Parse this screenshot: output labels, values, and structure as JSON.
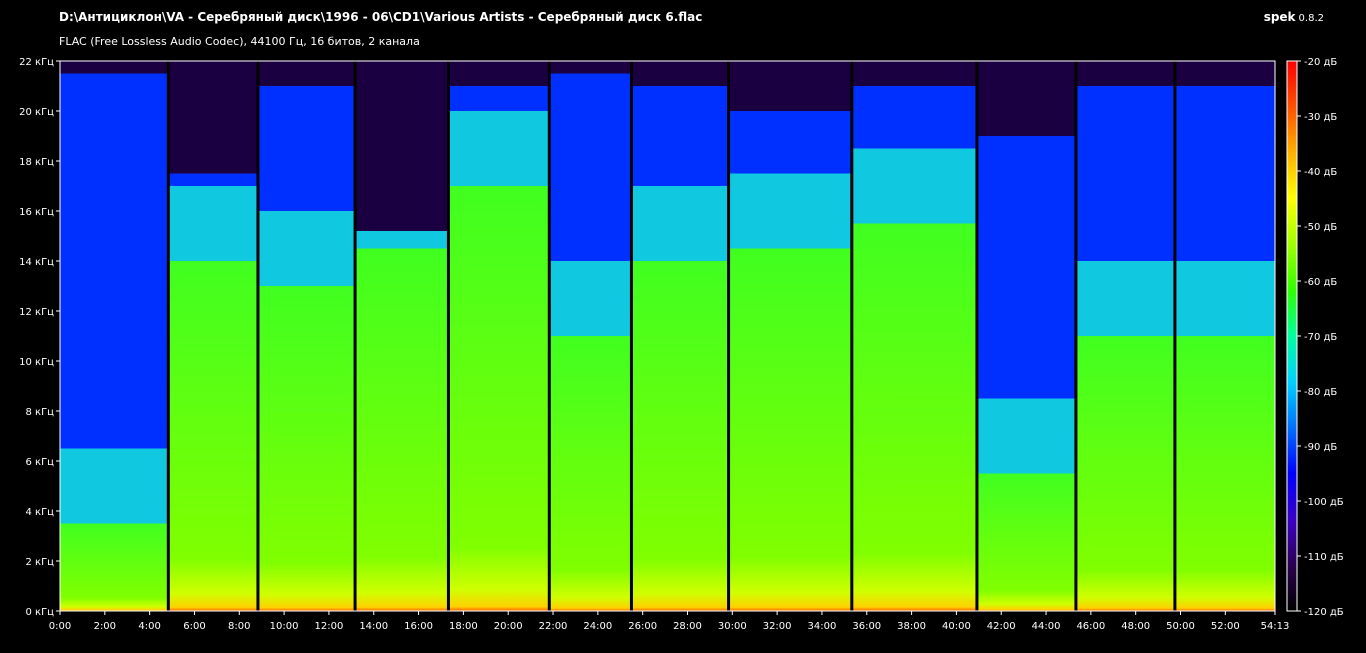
{
  "header": {
    "file_path": "D:\\Антициклон\\VA - Серебряный диск\\1996 - 06\\CD1\\Various Artists - Серебряный диск 6.flac",
    "app_name": "spek",
    "app_version": "0.8.2",
    "file_info": "FLAC (Free Lossless Audio Codec), 44100 Гц, 16 битов, 2 канала"
  },
  "chart_data": {
    "type": "heatmap",
    "title": "",
    "x_axis": {
      "unit": "time",
      "range": [
        "0:00",
        "54:13"
      ],
      "range_seconds": [
        0,
        3253
      ],
      "tick_labels": [
        "0:00",
        "2:00",
        "4:00",
        "6:00",
        "8:00",
        "10:00",
        "12:00",
        "14:00",
        "16:00",
        "18:00",
        "20:00",
        "22:00",
        "24:00",
        "26:00",
        "28:00",
        "30:00",
        "32:00",
        "34:00",
        "36:00",
        "38:00",
        "40:00",
        "42:00",
        "44:00",
        "46:00",
        "48:00",
        "50:00",
        "52:00",
        "54:13"
      ],
      "tick_seconds": [
        0,
        120,
        240,
        360,
        480,
        600,
        720,
        840,
        960,
        1080,
        1200,
        1320,
        1440,
        1560,
        1680,
        1800,
        1920,
        2040,
        2160,
        2280,
        2400,
        2520,
        2640,
        2760,
        2880,
        3000,
        3120,
        3253
      ]
    },
    "y_axis": {
      "unit": "кГц",
      "range": [
        0,
        22
      ],
      "tick_labels": [
        "0 кГц",
        "2 кГц",
        "4 кГц",
        "6 кГц",
        "8 кГц",
        "10 кГц",
        "12 кГц",
        "14 кГц",
        "16 кГц",
        "18 кГц",
        "20 кГц",
        "22 кГц"
      ],
      "tick_values": [
        0,
        2,
        4,
        6,
        8,
        10,
        12,
        14,
        16,
        18,
        20,
        22
      ]
    },
    "color_scale": {
      "unit": "дБ",
      "range": [
        -120,
        -20
      ],
      "tick_labels": [
        "-20 дБ",
        "-30 дБ",
        "-40 дБ",
        "-50 дБ",
        "-60 дБ",
        "-70 дБ",
        "-80 дБ",
        "-90 дБ",
        "-100 дБ",
        "-110 дБ",
        "-120 дБ"
      ],
      "tick_values": [
        -20,
        -30,
        -40,
        -50,
        -60,
        -70,
        -80,
        -90,
        -100,
        -110,
        -120
      ],
      "gradient": [
        "#000000",
        "#2a0050",
        "#3a00c8",
        "#0000ff",
        "#0070ff",
        "#00d0ff",
        "#00ffa0",
        "#30ff00",
        "#a0ff00",
        "#ffff00",
        "#ffb000",
        "#ff5000",
        "#ff0000"
      ]
    },
    "track_boundaries_seconds": [
      290,
      530,
      790,
      1040,
      1310,
      1530,
      1790,
      2120,
      2455,
      2720,
      2985
    ],
    "tracks": [
      {
        "start": 0,
        "end": 290,
        "cutoff_khz": 21.5,
        "green_top_khz": 3.5
      },
      {
        "start": 290,
        "end": 530,
        "cutoff_khz": 17.5,
        "green_top_khz": 14.0
      },
      {
        "start": 530,
        "end": 790,
        "cutoff_khz": 21.0,
        "green_top_khz": 13.0
      },
      {
        "start": 790,
        "end": 1040,
        "cutoff_khz": 15.2,
        "green_top_khz": 14.5
      },
      {
        "start": 1040,
        "end": 1310,
        "cutoff_khz": 21.0,
        "green_top_khz": 17.0
      },
      {
        "start": 1310,
        "end": 1530,
        "cutoff_khz": 21.5,
        "green_top_khz": 11.0
      },
      {
        "start": 1530,
        "end": 1790,
        "cutoff_khz": 21.0,
        "green_top_khz": 14.0
      },
      {
        "start": 1790,
        "end": 2120,
        "cutoff_khz": 20.0,
        "green_top_khz": 14.5
      },
      {
        "start": 2120,
        "end": 2455,
        "cutoff_khz": 21.0,
        "green_top_khz": 15.5
      },
      {
        "start": 2455,
        "end": 2720,
        "cutoff_khz": 19.0,
        "green_top_khz": 5.5
      },
      {
        "start": 2720,
        "end": 2985,
        "cutoff_khz": 21.0,
        "green_top_khz": 11.0
      },
      {
        "start": 2985,
        "end": 3253,
        "cutoff_khz": 21.0,
        "green_top_khz": 11.0
      }
    ]
  }
}
